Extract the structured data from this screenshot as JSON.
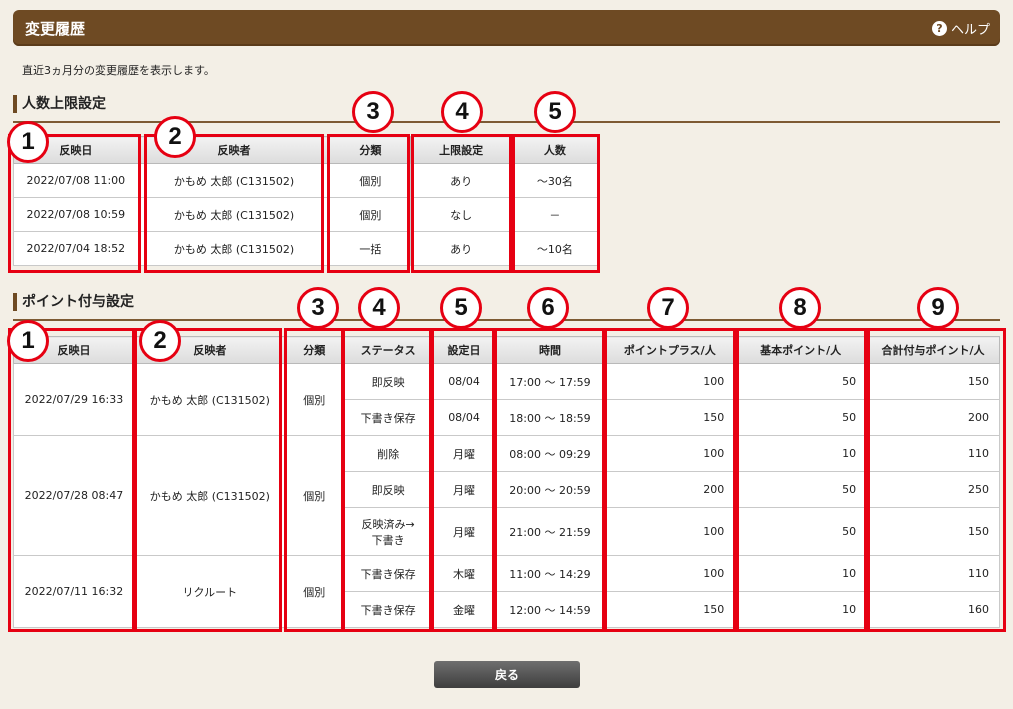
{
  "header": {
    "title": "変更履歴",
    "help_label": "ヘルプ",
    "help_icon": "?"
  },
  "description": "直近3ヵ月分の変更履歴を表示します。",
  "capacity": {
    "title": "人数上限設定",
    "columns": [
      "反映日",
      "反映者",
      "分類",
      "上限設定",
      "人数"
    ],
    "rows": [
      [
        "2022/07/08 11:00",
        "かもめ 太郎 (C131502)",
        "個別",
        "あり",
        "～30名"
      ],
      [
        "2022/07/08 10:59",
        "かもめ 太郎 (C131502)",
        "個別",
        "なし",
        "－"
      ],
      [
        "2022/07/04 18:52",
        "かもめ 太郎 (C131502)",
        "一括",
        "あり",
        "～10名"
      ]
    ]
  },
  "points": {
    "title": "ポイント付与設定",
    "columns": [
      "反映日",
      "反映者",
      "分類",
      "ステータス",
      "設定日",
      "時間",
      "ポイントプラス/人",
      "基本ポイント/人",
      "合計付与ポイント/人"
    ],
    "groups": [
      {
        "date": "2022/07/29 16:33",
        "user": "かもめ 太郎 (C131502)",
        "category": "個別",
        "rows": [
          [
            "即反映",
            "08/04",
            "17:00 ～ 17:59",
            "100",
            "50",
            "150"
          ],
          [
            "下書き保存",
            "08/04",
            "18:00 ～ 18:59",
            "150",
            "50",
            "200"
          ]
        ]
      },
      {
        "date": "2022/07/28 08:47",
        "user": "かもめ 太郎 (C131502)",
        "category": "個別",
        "rows": [
          [
            "削除",
            "月曜",
            "08:00 ～ 09:29",
            "100",
            "10",
            "110"
          ],
          [
            "即反映",
            "月曜",
            "20:00 ～ 20:59",
            "200",
            "50",
            "250"
          ],
          [
            "反映済み→\n下書き",
            "月曜",
            "21:00 ～ 21:59",
            "100",
            "50",
            "150"
          ]
        ]
      },
      {
        "date": "2022/07/11 16:32",
        "user": "リクルート",
        "category": "個別",
        "rows": [
          [
            "下書き保存",
            "木曜",
            "11:00 ～ 14:29",
            "100",
            "10",
            "110"
          ],
          [
            "下書き保存",
            "金曜",
            "12:00 ～ 14:59",
            "150",
            "10",
            "160"
          ]
        ]
      }
    ]
  },
  "markers": {
    "capacity": [
      "1",
      "2",
      "3",
      "4",
      "5"
    ],
    "points": [
      "1",
      "2",
      "3",
      "4",
      "5",
      "6",
      "7",
      "8",
      "9"
    ]
  },
  "back_button": "戻る",
  "colors": {
    "header_bg": "#6e4a23",
    "annotation_red": "#e60012",
    "page_bg": "#f3efe6"
  }
}
